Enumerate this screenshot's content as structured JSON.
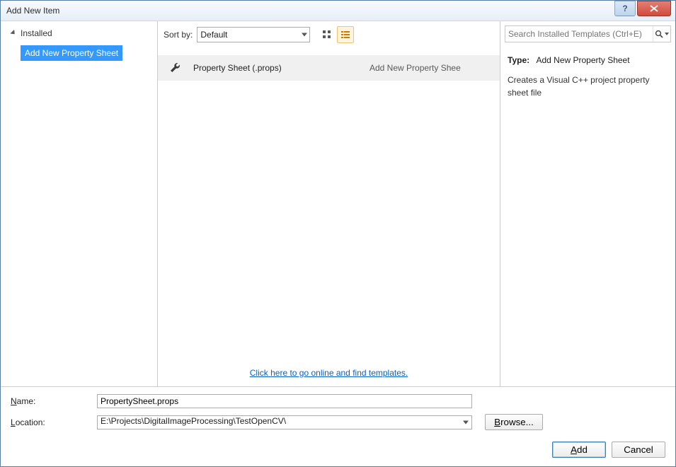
{
  "window": {
    "title": "Add New Item"
  },
  "sidebar": {
    "category": "Installed",
    "items": [
      {
        "label": "Add New Property Sheet",
        "selected": true
      }
    ]
  },
  "toolbar": {
    "sort_label": "Sort by:",
    "sort_value": "Default"
  },
  "search": {
    "placeholder": "Search Installed Templates (Ctrl+E)"
  },
  "templates": [
    {
      "name": "Property Sheet (.props)",
      "category": "Add New Property Shee"
    }
  ],
  "online_link": "Click here to go online and find templates.",
  "detail": {
    "type_label": "Type:",
    "type_value": "Add New Property Sheet",
    "description": "Creates a Visual C++ project property sheet file"
  },
  "form": {
    "name_label_pre": "N",
    "name_label_rest": "ame:",
    "name_value": "PropertySheet.props",
    "location_label_pre": "L",
    "location_label_rest": "ocation:",
    "location_value": "E:\\Projects\\DigitalImageProcessing\\TestOpenCV\\",
    "browse_label": "Browse..."
  },
  "buttons": {
    "add": "Add",
    "cancel": "Cancel"
  }
}
